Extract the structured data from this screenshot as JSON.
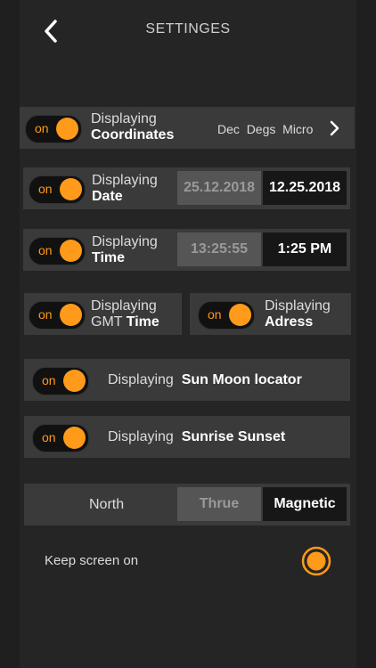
{
  "header": {
    "title": "SETTINGES"
  },
  "toggle_on_label": "on",
  "coords": {
    "label": "Displaying",
    "name": "Coordinates",
    "formats": [
      "Dec",
      "Degs",
      "Micro"
    ]
  },
  "date": {
    "label": "Displaying",
    "name": "Date",
    "option_a": "25.12.2018",
    "option_b": "12.25.2018"
  },
  "time": {
    "label": "Displaying",
    "name": "Time",
    "option_a": "13:25:55",
    "option_b": "1:25 PM"
  },
  "gmt": {
    "label": "Displaying",
    "prefix": "GMT",
    "name": "Time"
  },
  "address": {
    "label": "Displaying",
    "name": "Adress"
  },
  "sunmoon": {
    "label": "Displaying",
    "name": "Sun Moon locator"
  },
  "sunrise": {
    "label": "Displaying",
    "name": "Sunrise Sunset"
  },
  "north": {
    "label": "North",
    "options": [
      "Thrue",
      "Magnetic"
    ],
    "selected": "Magnetic"
  },
  "keep_screen": {
    "label": "Keep screen on",
    "checked": true
  },
  "colors": {
    "accent": "#ff9a1a",
    "row_bg": "#3a3a3a",
    "page_bg": "#252525"
  }
}
